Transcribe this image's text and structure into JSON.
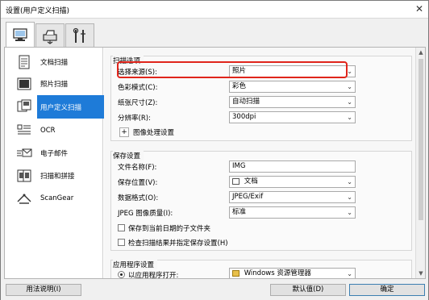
{
  "window": {
    "title": "设置(用户定义扫描)",
    "close": "✕"
  },
  "tabs": [
    {
      "name": "scan-from-computer-tab"
    },
    {
      "name": "scan-from-panel-tab"
    },
    {
      "name": "general-settings-tab"
    }
  ],
  "sidebar": {
    "items": [
      {
        "label": "文档扫描"
      },
      {
        "label": "照片扫描"
      },
      {
        "label": "用户定义扫描"
      },
      {
        "label": "OCR"
      },
      {
        "label": "电子邮件"
      },
      {
        "label": "扫描和拼接"
      },
      {
        "label": "ScanGear"
      }
    ]
  },
  "scan_options": {
    "title": "扫描选项",
    "source_label": "选择来源(S):",
    "source_value": "照片",
    "color_label": "色彩模式(C):",
    "color_value": "彩色",
    "size_label": "纸张尺寸(Z):",
    "size_value": "自动扫描",
    "resolution_label": "分辨率(R):",
    "resolution_value": "300dpi",
    "image_processing_label": "图像处理设置"
  },
  "save_settings": {
    "title": "保存设置",
    "filename_label": "文件名称(F):",
    "filename_value": "IMG",
    "location_label": "保存位置(V):",
    "location_value": "文档",
    "format_label": "数据格式(O):",
    "format_value": "JPEG/Exif",
    "quality_label": "JPEG 图像质量(I):",
    "quality_value": "标准",
    "subfolder_label": "保存到当前日期的子文件夹",
    "check_results_label": "检查扫描结果并指定保存设置(H)"
  },
  "app_settings": {
    "title": "应用程序设置",
    "open_with_label": "以应用程序打开:",
    "open_with_value": "Windows 资源管理器"
  },
  "footer": {
    "help_label": "用法说明(I)",
    "defaults_label": "默认值(D)",
    "ok_label": "确定"
  }
}
